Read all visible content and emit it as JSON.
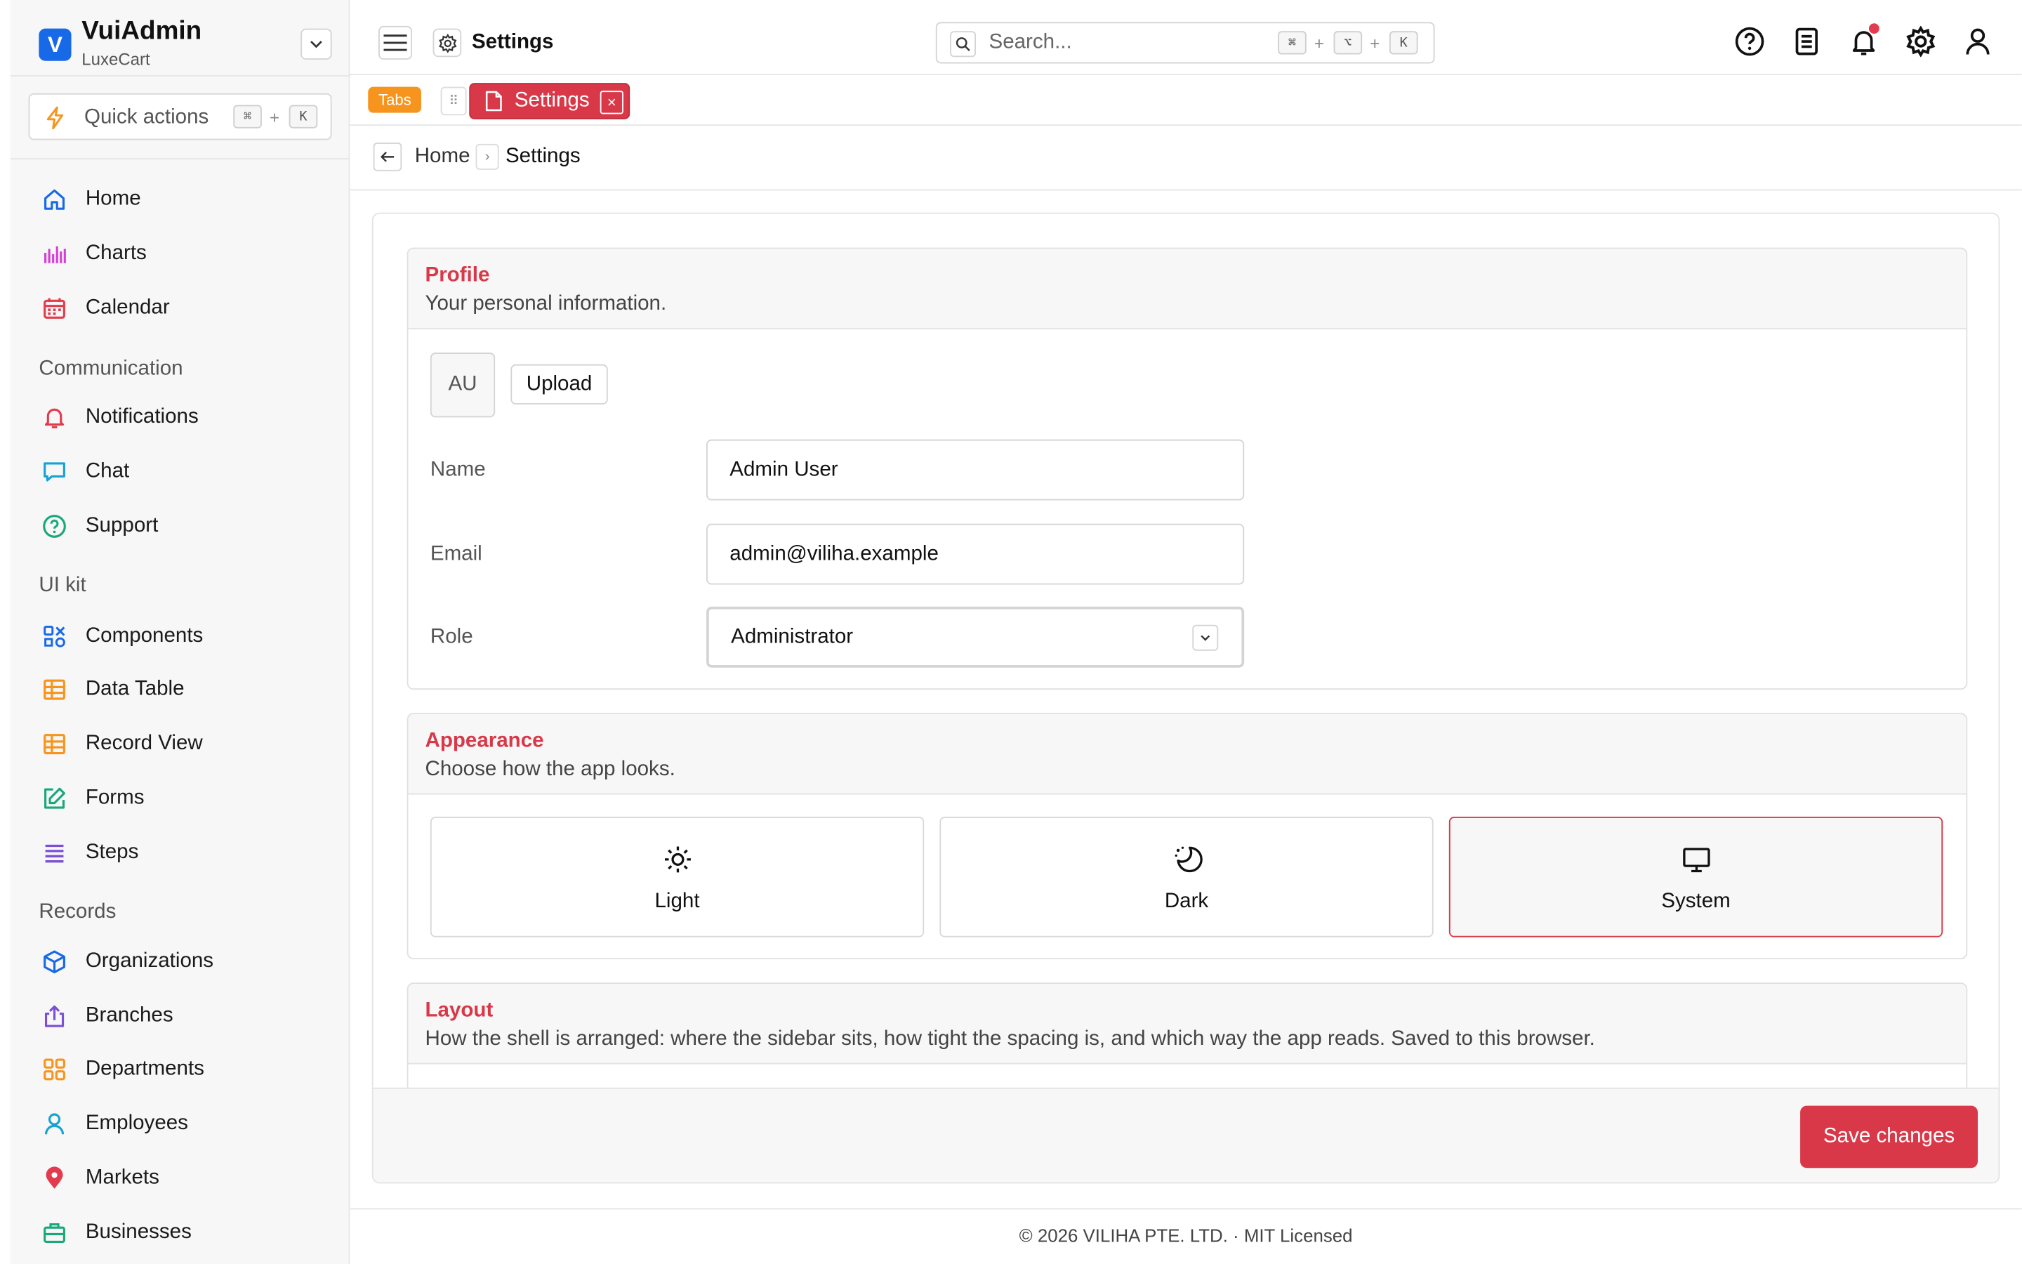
{
  "brand": {
    "name": "VuiAdmin",
    "sub": "LuxeCart",
    "logo_letter": "V",
    "accent": "#1769e8"
  },
  "quick_actions": {
    "label": "Quick actions",
    "key1": "⌘",
    "plus": "+",
    "key2": "K"
  },
  "sidebar": {
    "items_top": [
      {
        "label": "Home",
        "icon": "home-icon",
        "color": "#1769e8"
      },
      {
        "label": "Charts",
        "icon": "bar-chart-icon",
        "color": "#d63fd6"
      },
      {
        "label": "Calendar",
        "icon": "calendar-icon",
        "color": "#e23b4d"
      }
    ],
    "sections": [
      {
        "title": "Communication",
        "items": [
          {
            "label": "Notifications",
            "icon": "bell-icon",
            "color": "#e23b4d"
          },
          {
            "label": "Chat",
            "icon": "chat-icon",
            "color": "#17a2d4"
          },
          {
            "label": "Support",
            "icon": "help-circle-icon",
            "color": "#19a87a"
          }
        ]
      },
      {
        "title": "UI kit",
        "items": [
          {
            "label": "Components",
            "icon": "components-icon",
            "color": "#1769e8"
          },
          {
            "label": "Data Table",
            "icon": "table-icon",
            "color": "#f7941d"
          },
          {
            "label": "Record View",
            "icon": "table-icon",
            "color": "#f7941d"
          },
          {
            "label": "Forms",
            "icon": "edit-icon",
            "color": "#19a87a"
          },
          {
            "label": "Steps",
            "icon": "list-icon",
            "color": "#7b4fd6"
          }
        ]
      },
      {
        "title": "Records",
        "items": [
          {
            "label": "Organizations",
            "icon": "cube-icon",
            "color": "#1769e8"
          },
          {
            "label": "Branches",
            "icon": "share-icon",
            "color": "#7b4fd6"
          },
          {
            "label": "Departments",
            "icon": "grid-icon",
            "color": "#f7941d"
          },
          {
            "label": "Employees",
            "icon": "user-icon",
            "color": "#17a2d4"
          },
          {
            "label": "Markets",
            "icon": "map-pin-icon",
            "color": "#e23b4d"
          },
          {
            "label": "Businesses",
            "icon": "briefcase-icon",
            "color": "#19a87a"
          }
        ]
      }
    ]
  },
  "header": {
    "title": "Settings",
    "search_placeholder": "Search...",
    "shortcut": [
      "⌘",
      "⌥",
      "K"
    ],
    "plus": "+"
  },
  "tabs": {
    "badge": "Tabs",
    "active_tab": "Settings",
    "close": "×",
    "accent": "#d93848"
  },
  "breadcrumb": {
    "home": "Home",
    "sep": "›",
    "current": "Settings"
  },
  "profile": {
    "title": "Profile",
    "desc": "Your personal information.",
    "avatar_initials": "AU",
    "upload_label": "Upload",
    "name_label": "Name",
    "name_value": "Admin User",
    "email_label": "Email",
    "email_value": "admin@viliha.example",
    "role_label": "Role",
    "role_value": "Administrator"
  },
  "appearance": {
    "title": "Appearance",
    "desc": "Choose how the app looks.",
    "options": [
      {
        "label": "Light",
        "icon": "sun-icon",
        "selected": false
      },
      {
        "label": "Dark",
        "icon": "moon-icon",
        "selected": false
      },
      {
        "label": "System",
        "icon": "monitor-icon",
        "selected": true
      }
    ]
  },
  "layout": {
    "title": "Layout",
    "desc": "How the shell is arranged: where the sidebar sits, how tight the spacing is, and which way the app reads. Saved to this browser."
  },
  "actions": {
    "save_label": "Save changes"
  },
  "footer": {
    "text": "© 2026 VILIHA PTE. LTD. · MIT Licensed"
  }
}
